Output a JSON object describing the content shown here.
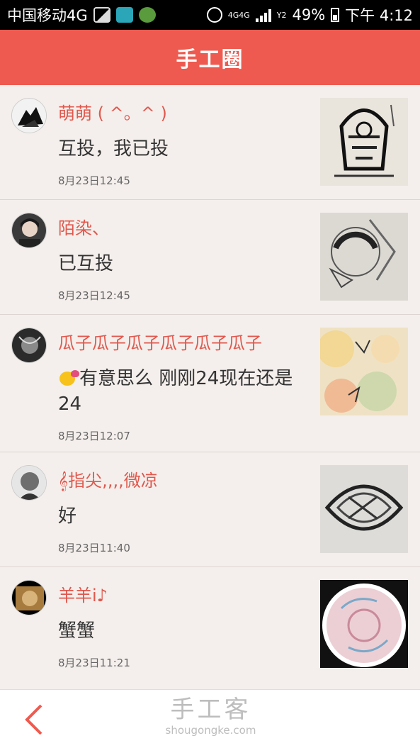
{
  "status_bar": {
    "carrier": "中国移动4G",
    "network_label_top": "4G4G",
    "sim_label": "Y2",
    "battery": "49%",
    "time": "下午 4:12"
  },
  "header": {
    "title": "手工圈"
  },
  "comments": [
    {
      "name": "萌萌 ( ^。^ )",
      "message": "互投，我已投",
      "time": "8月23日12:45"
    },
    {
      "name": "陌染、",
      "message": "已互投",
      "time": "8月23日12:45"
    },
    {
      "name": "瓜子瓜子瓜子瓜子瓜子瓜子",
      "message": "有意思么 刚刚24现在还是24",
      "time": "8月23日12:07"
    },
    {
      "name": "𝄞指尖,,,,微凉",
      "message": "好",
      "time": "8月23日11:40"
    },
    {
      "name": "羊羊i♪",
      "message": "蟹蟹",
      "time": "8月23日11:21"
    }
  ],
  "footer": {
    "watermark_title": "手工客",
    "watermark_url": "shougongke.com"
  },
  "colors": {
    "accent": "#ee5a4f",
    "name": "#e0584d",
    "background": "#f4efec"
  }
}
